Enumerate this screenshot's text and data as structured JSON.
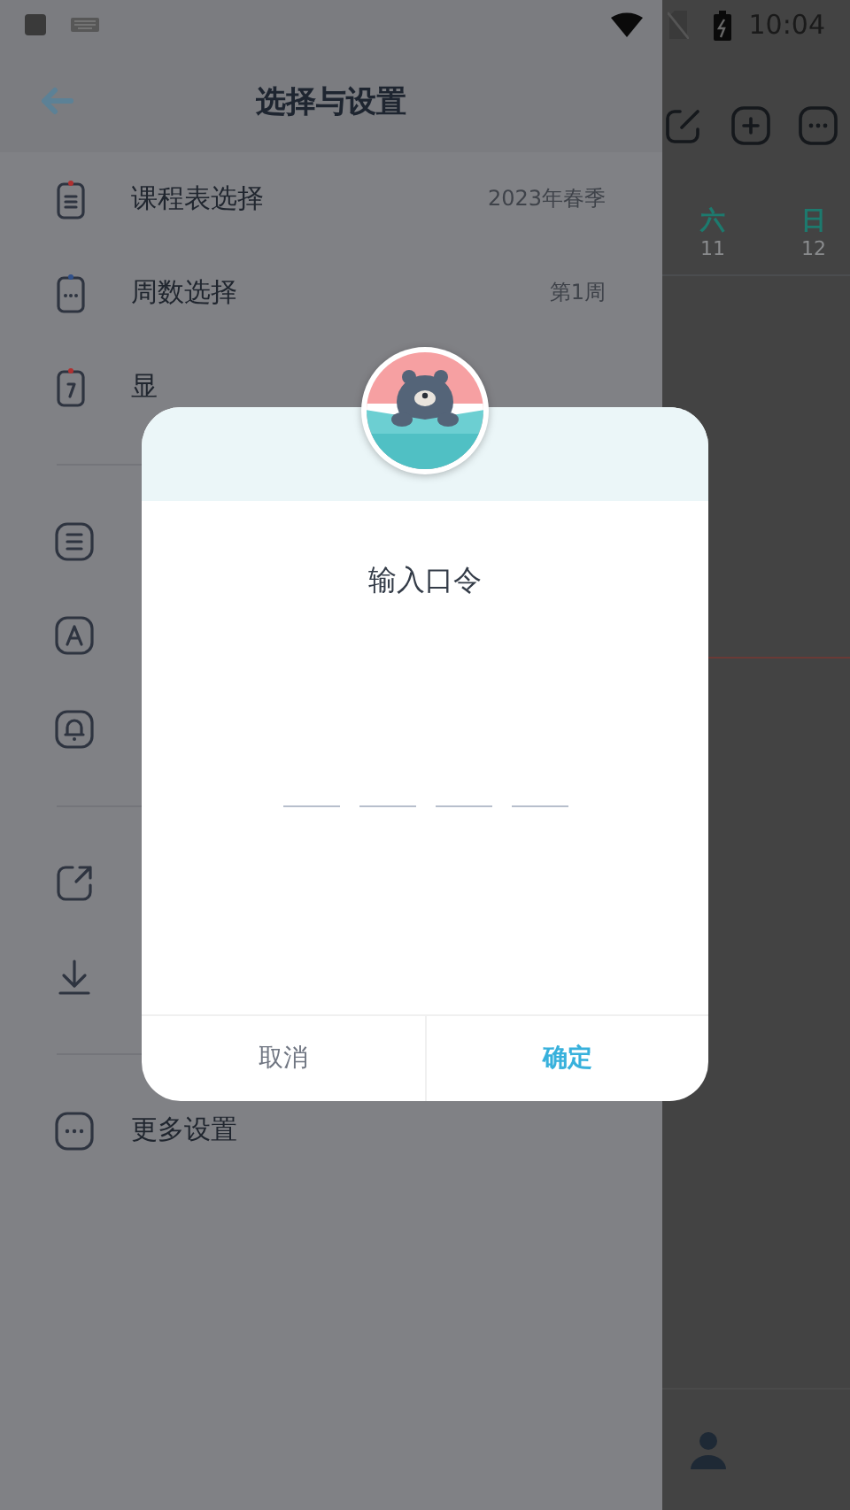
{
  "status_bar": {
    "time": "10:04"
  },
  "drawer": {
    "title": "选择与设置",
    "groups": [
      [
        {
          "label": "课程表选择",
          "value": "2023年春季"
        },
        {
          "label": "周数选择",
          "value": "第1周"
        },
        {
          "label": "显"
        }
      ],
      [
        {
          "label": "更多设置"
        }
      ]
    ]
  },
  "schedule": {
    "days": [
      {
        "name": "六",
        "date": "11"
      },
      {
        "name": "日",
        "date": "12"
      }
    ]
  },
  "dialog": {
    "title": "输入口令",
    "slots": [
      {
        "filled": false
      },
      {
        "filled": false
      },
      {
        "filled": false
      },
      {
        "filled": false
      }
    ],
    "buttons": [
      {
        "label": "取消",
        "kind": "cancel"
      },
      {
        "label": "确定",
        "kind": "confirm"
      }
    ]
  }
}
